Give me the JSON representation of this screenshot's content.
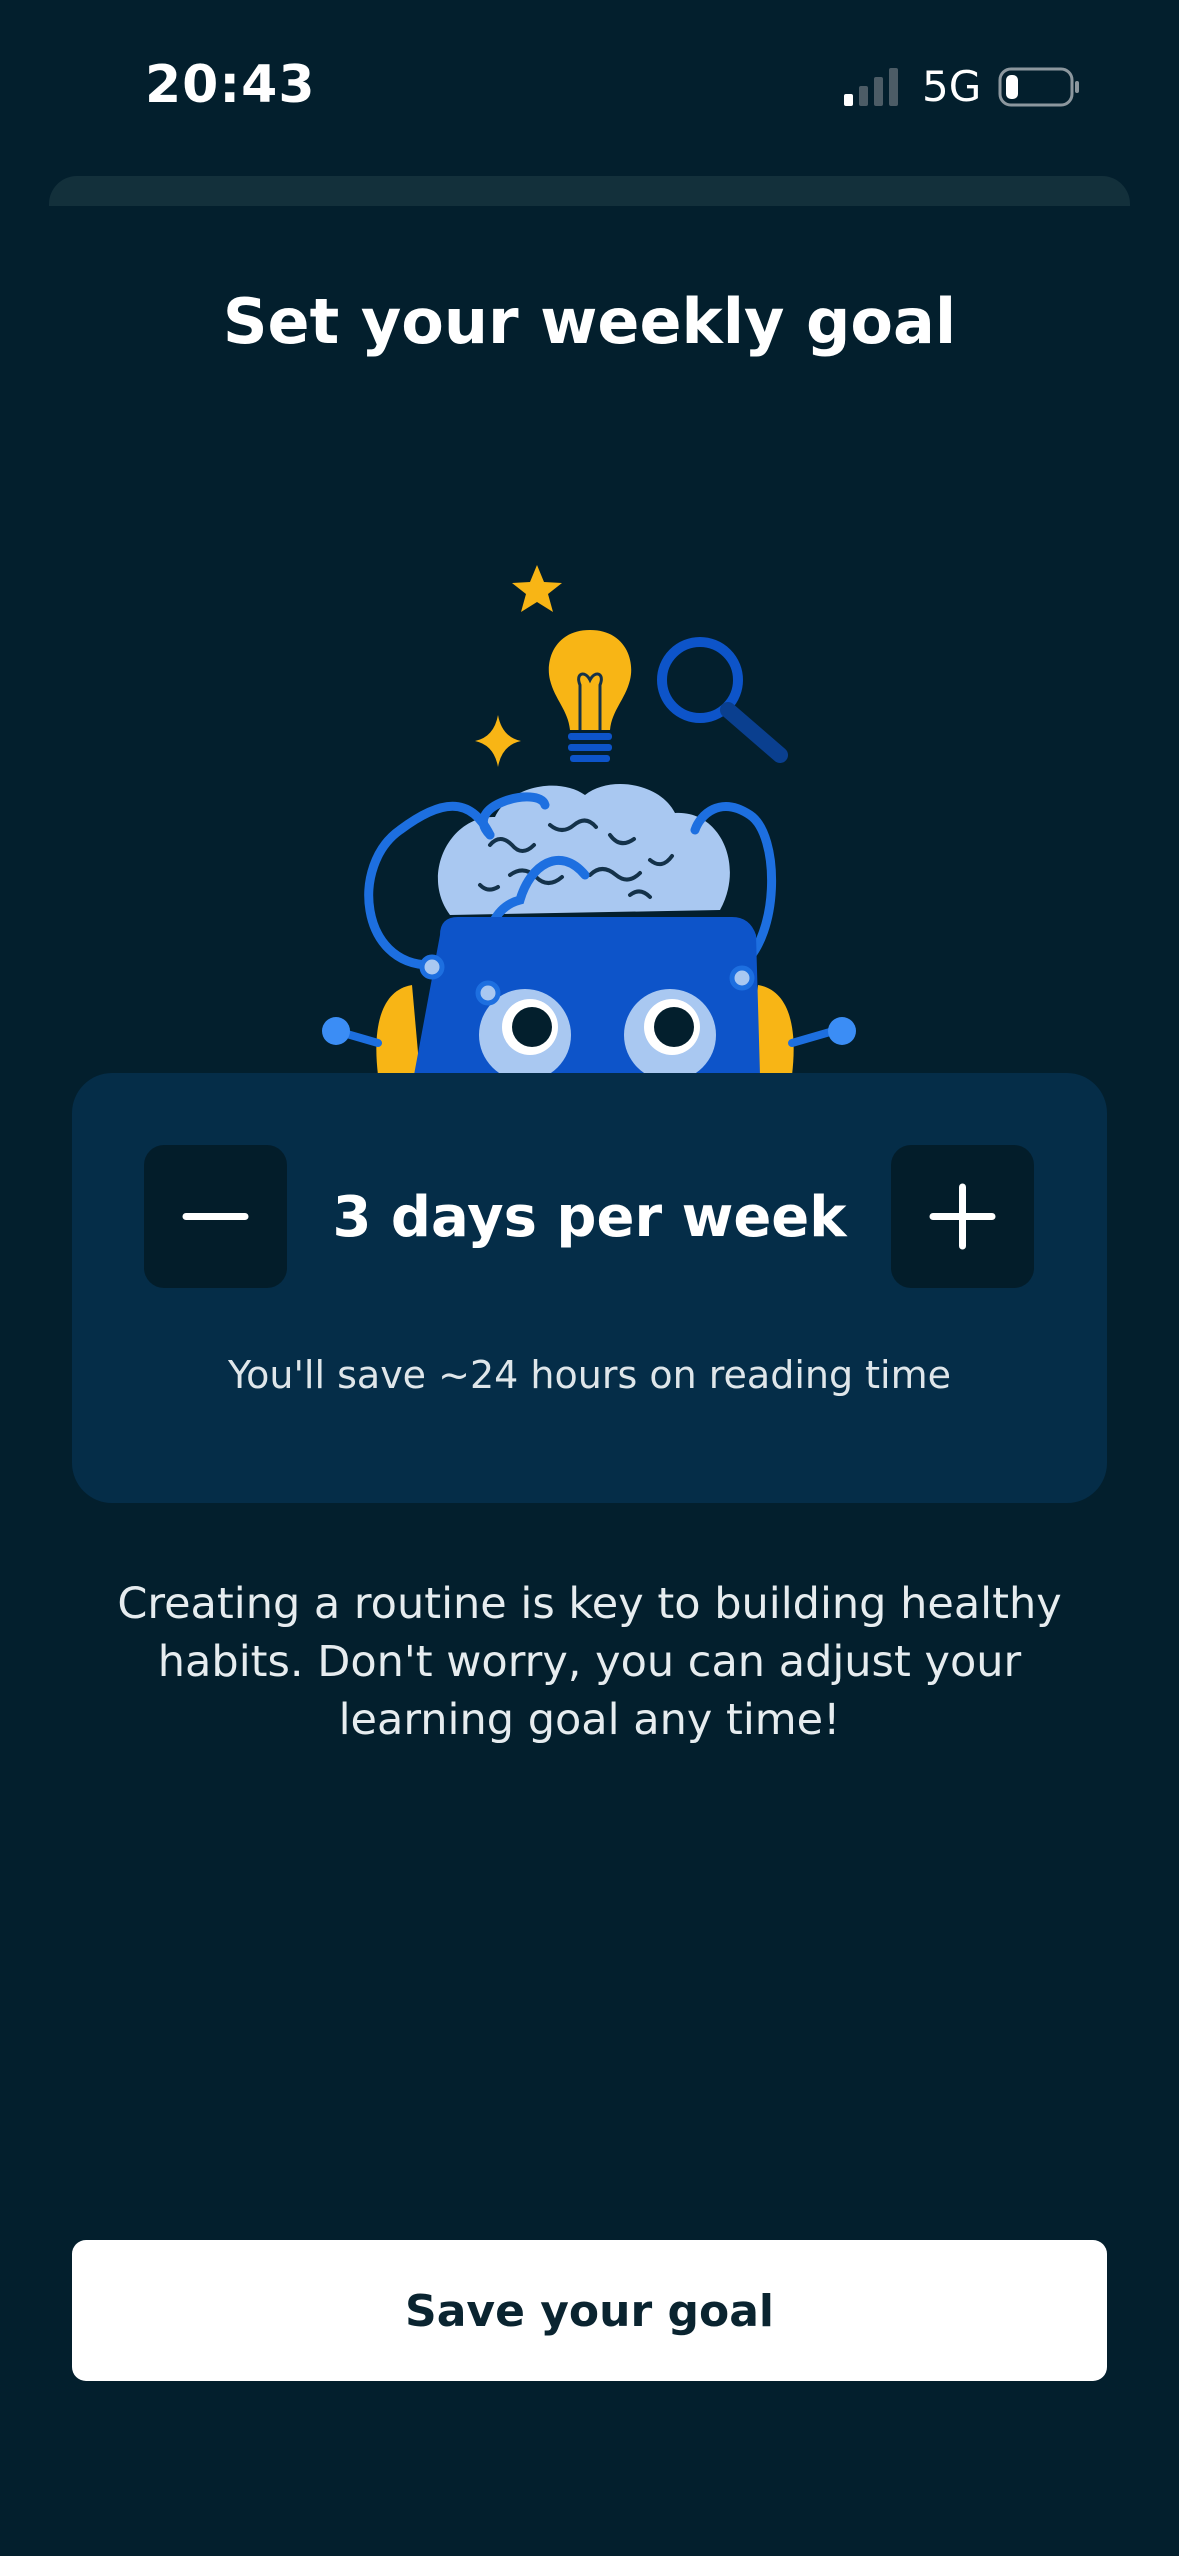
{
  "status_bar": {
    "time": "20:43",
    "network": "5G",
    "signal_icon": "cellular-signal-icon",
    "battery_icon": "battery-low-icon"
  },
  "page": {
    "title": "Set your weekly goal"
  },
  "illustration": {
    "name": "brain-robot-illustration",
    "elements": [
      "star-icon",
      "sparkle-icon",
      "lightbulb-icon",
      "magnifier-icon",
      "brain",
      "robot-face"
    ]
  },
  "goal_card": {
    "minus_icon": "minus-icon",
    "plus_icon": "plus-icon",
    "value_label": "3 days per week",
    "savings_text": "You'll save ~24 hours on reading time"
  },
  "description": "Creating a routine is key to building healthy habits. Don't worry, you can adjust your learning goal any time!",
  "footer": {
    "save_label": "Save your goal"
  },
  "colors": {
    "background": "#031f2d",
    "card": "#052d48",
    "button_dark": "#031d2a",
    "accent_blue": "#0d54c9",
    "accent_yellow": "#f8b515",
    "brain": "#a9c8f1"
  }
}
